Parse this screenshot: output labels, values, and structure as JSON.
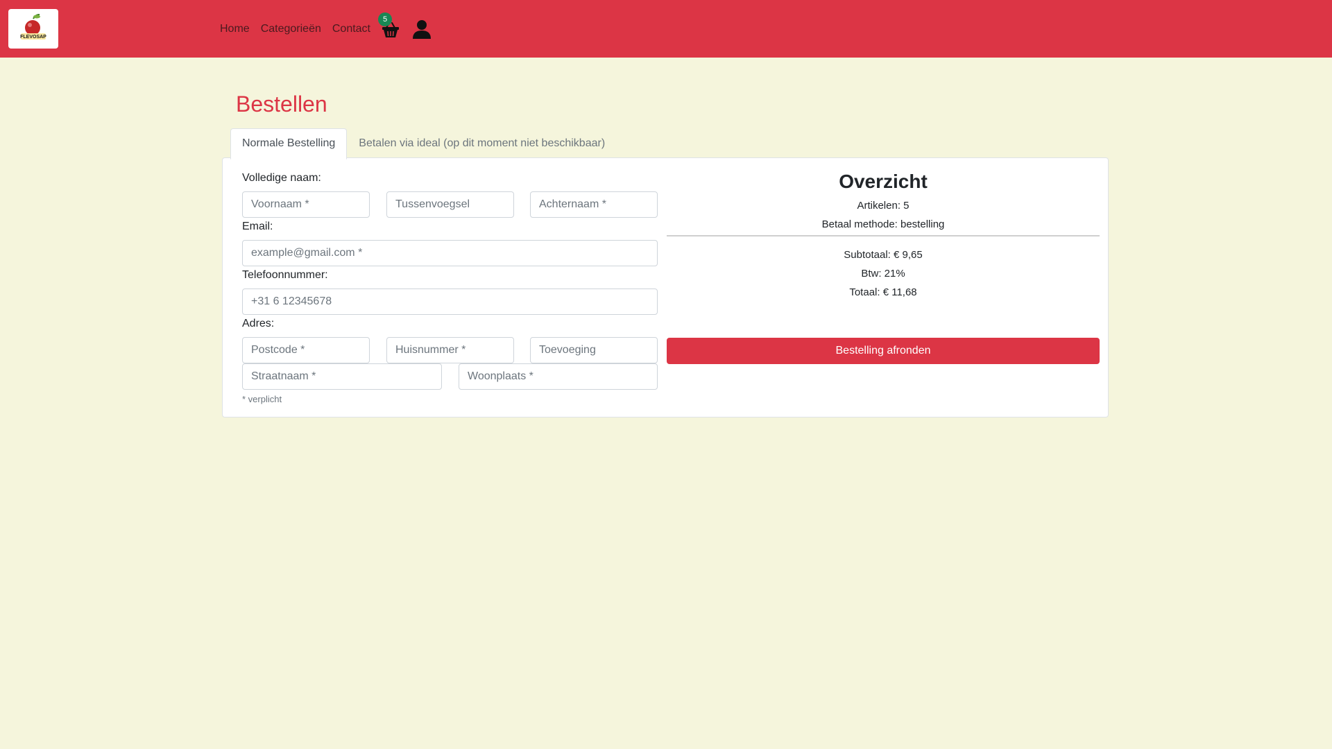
{
  "header": {
    "logo_text": "FLEVOSAP",
    "nav": [
      {
        "label": "Home"
      },
      {
        "label": "Categorieën"
      },
      {
        "label": "Contact"
      }
    ],
    "cart_count": "5"
  },
  "page": {
    "title": "Bestellen",
    "tabs": [
      {
        "label": "Normale Bestelling",
        "active": true
      },
      {
        "label": "Betalen via ideal (op dit moment niet beschikbaar)",
        "active": false
      }
    ]
  },
  "form": {
    "name_label": "Volledige naam:",
    "firstname_placeholder": "Voornaam *",
    "middlename_placeholder": "Tussenvoegsel",
    "lastname_placeholder": "Achternaam *",
    "email_label": "Email:",
    "email_placeholder": "example@gmail.com *",
    "phone_label": "Telefoonnummer:",
    "phone_placeholder": "+31 6 12345678",
    "address_label": "Adres:",
    "postcode_placeholder": "Postcode *",
    "housenumber_placeholder": "Huisnummer *",
    "addition_placeholder": "Toevoeging",
    "street_placeholder": "Straatnaam *",
    "city_placeholder": "Woonplaats *",
    "required_note": "* verplicht"
  },
  "overview": {
    "title": "Overzicht",
    "articles": "Artikelen: 5",
    "payment_method": "Betaal methode: bestelling",
    "subtotal": "Subtotaal: € 9,65",
    "vat": "Btw: 21%",
    "total": "Totaal: € 11,68",
    "submit_label": "Bestelling afronden"
  },
  "colors": {
    "brand_red": "#dc3545",
    "background": "#f5f5dc",
    "badge_green": "#198754"
  }
}
